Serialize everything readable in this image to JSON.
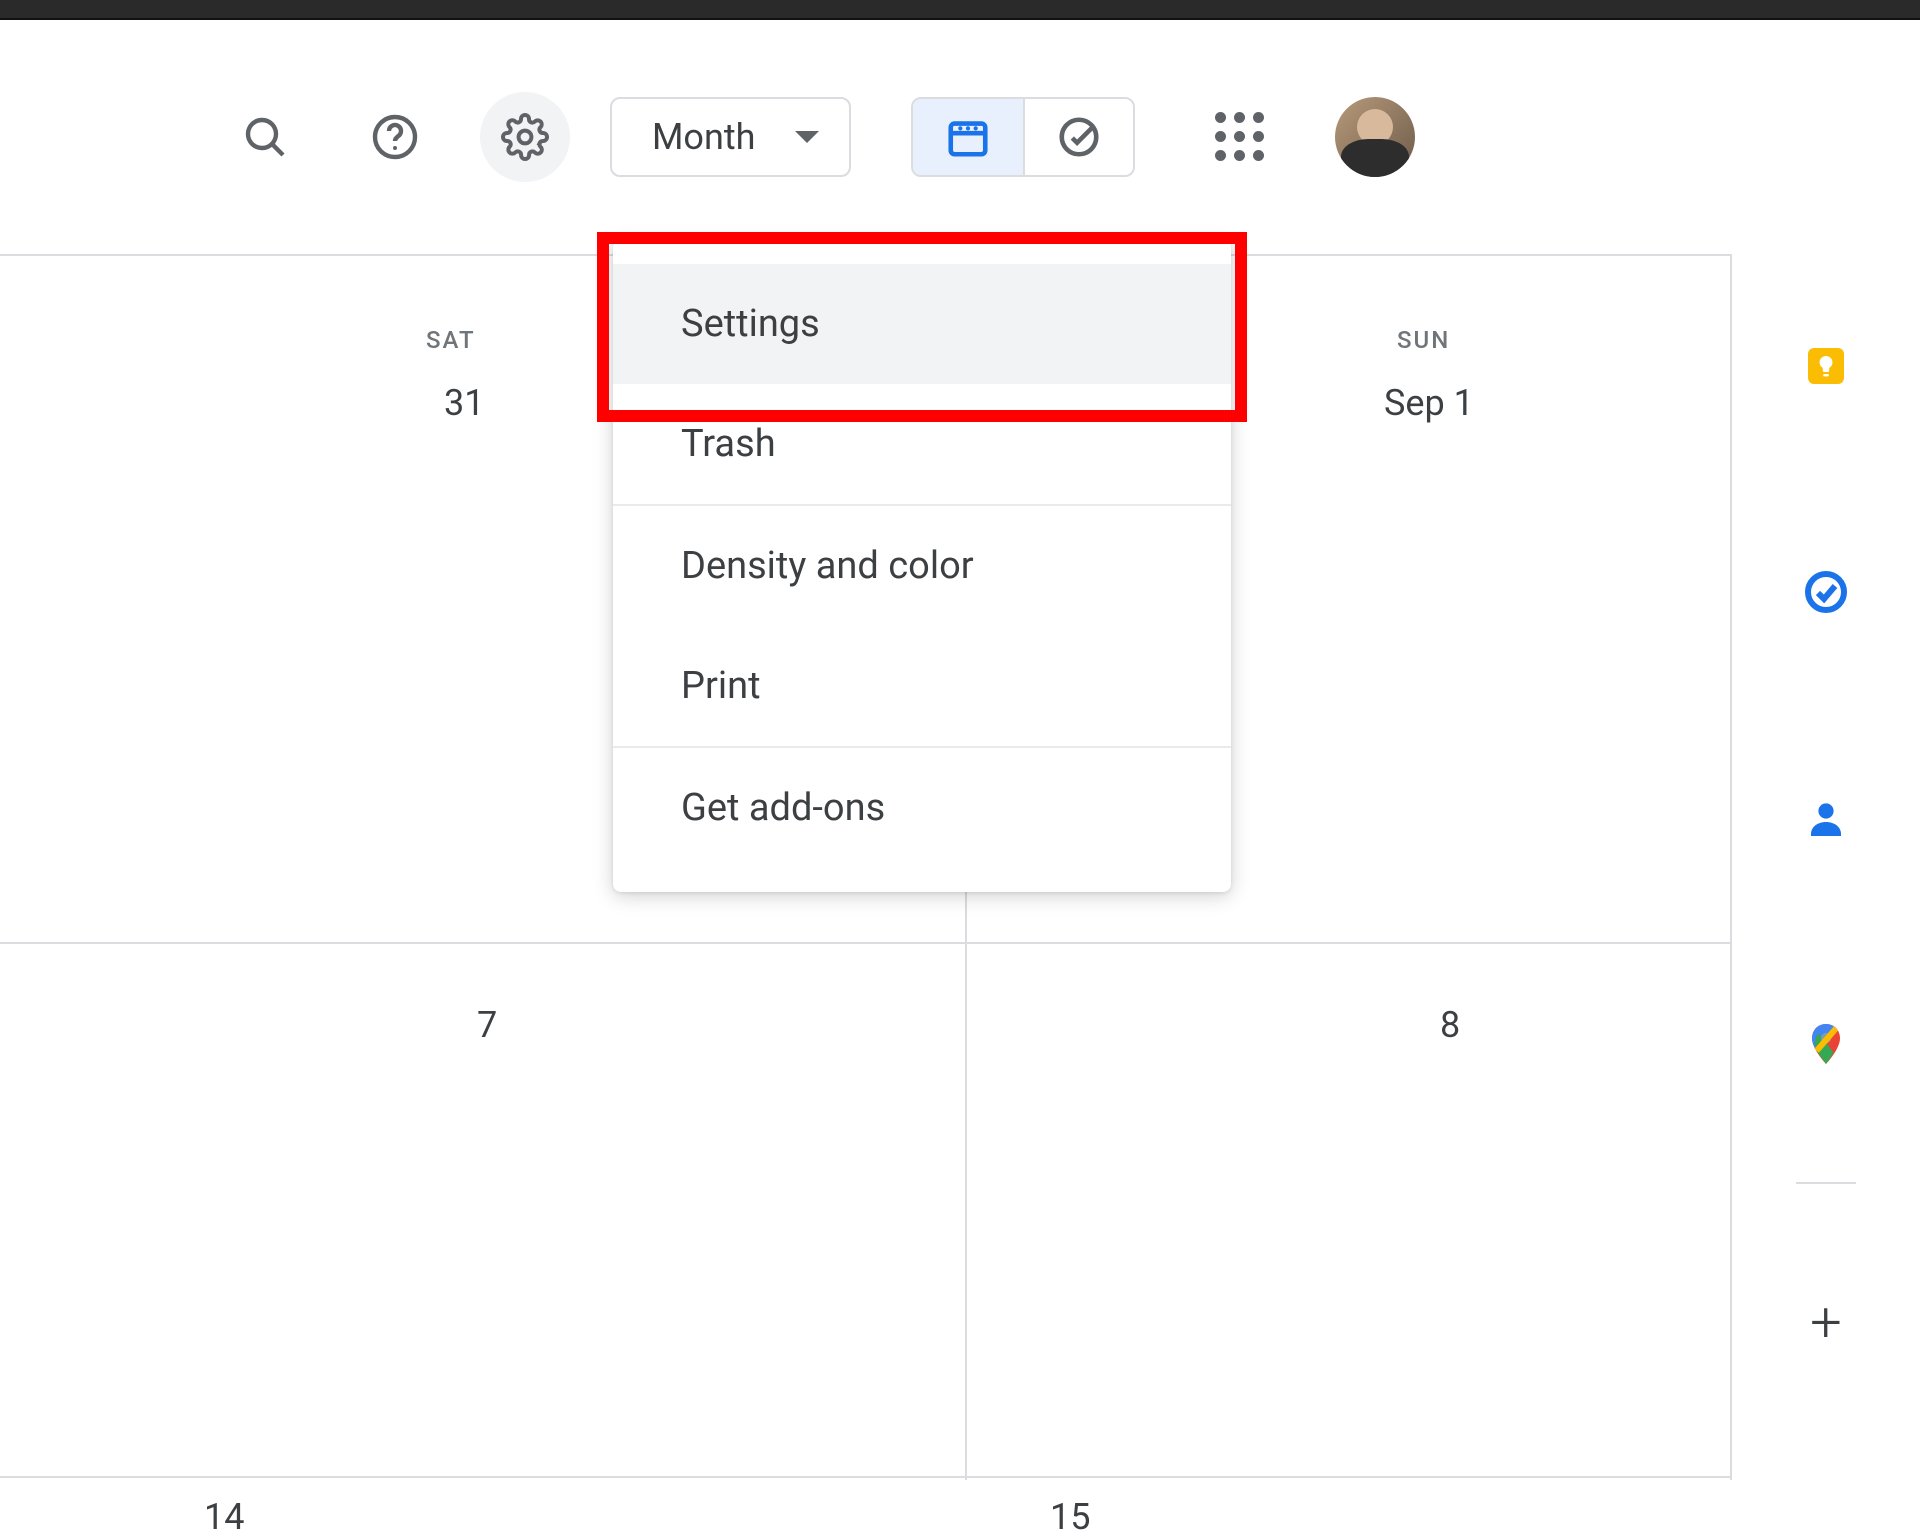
{
  "header": {
    "view_label": "Month"
  },
  "menu": {
    "settings": "Settings",
    "trash": "Trash",
    "density": "Density and color",
    "print": "Print",
    "addons": "Get add-ons"
  },
  "calendar": {
    "days": {
      "sat_label": "SAT",
      "sun_label": "SUN",
      "sat_date": "31",
      "sun_date": "Sep 1",
      "row2_left": "7",
      "row2_right": "8",
      "row3_left": "14",
      "row3_right": "15"
    }
  }
}
